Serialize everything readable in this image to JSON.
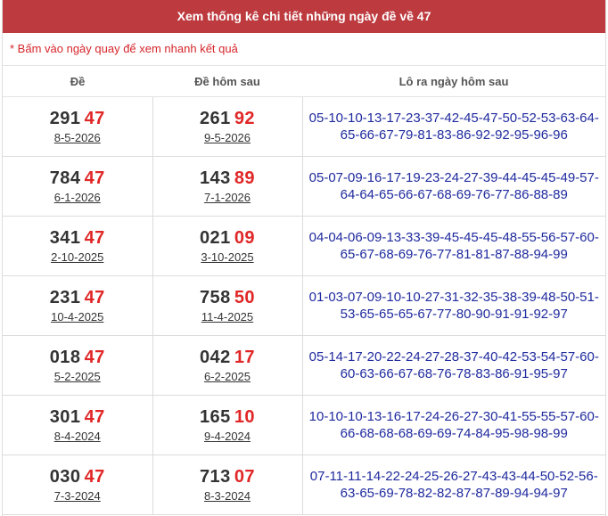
{
  "header": {
    "title": "Xem thống kê chi tiết những ngày đề về 47"
  },
  "note": "* Bấm vào ngày quay để xem nhanh kết quả",
  "columns": [
    "Đề",
    "Đề hôm sau",
    "Lô ra ngày hôm sau"
  ],
  "rows": [
    {
      "de_prefix": "291",
      "de_tail": "47",
      "de_date": "8-5-2026",
      "next_prefix": "261",
      "next_tail": "92",
      "next_date": "9-5-2026",
      "lo": "05-10-10-13-17-23-37-42-45-47-50-52-53-63-64-65-66-67-79-81-83-86-92-92-95-96-96"
    },
    {
      "de_prefix": "784",
      "de_tail": "47",
      "de_date": "6-1-2026",
      "next_prefix": "143",
      "next_tail": "89",
      "next_date": "7-1-2026",
      "lo": "05-07-09-16-17-19-23-24-27-39-44-45-45-49-57-64-64-65-66-67-68-69-76-77-86-88-89"
    },
    {
      "de_prefix": "341",
      "de_tail": "47",
      "de_date": "2-10-2025",
      "next_prefix": "021",
      "next_tail": "09",
      "next_date": "3-10-2025",
      "lo": "04-04-06-09-13-33-39-45-45-45-48-55-56-57-60-65-67-68-69-76-77-81-81-87-88-94-99"
    },
    {
      "de_prefix": "231",
      "de_tail": "47",
      "de_date": "10-4-2025",
      "next_prefix": "758",
      "next_tail": "50",
      "next_date": "11-4-2025",
      "lo": "01-03-07-09-10-10-27-31-32-35-38-39-48-50-51-53-65-65-65-67-77-80-90-91-91-92-97"
    },
    {
      "de_prefix": "018",
      "de_tail": "47",
      "de_date": "5-2-2025",
      "next_prefix": "042",
      "next_tail": "17",
      "next_date": "6-2-2025",
      "lo": "05-14-17-20-22-24-27-28-37-40-42-53-54-57-60-60-63-66-67-68-76-78-83-86-91-95-97"
    },
    {
      "de_prefix": "301",
      "de_tail": "47",
      "de_date": "8-4-2024",
      "next_prefix": "165",
      "next_tail": "10",
      "next_date": "9-4-2024",
      "lo": "10-10-10-13-16-17-24-26-27-30-41-55-55-57-60-66-68-68-68-69-69-74-84-95-98-98-99"
    },
    {
      "de_prefix": "030",
      "de_tail": "47",
      "de_date": "7-3-2024",
      "next_prefix": "713",
      "next_tail": "07",
      "next_date": "8-3-2024",
      "lo": "07-11-11-14-22-24-25-26-27-43-43-44-50-52-56-63-65-69-78-82-82-87-87-89-94-94-97"
    }
  ]
}
